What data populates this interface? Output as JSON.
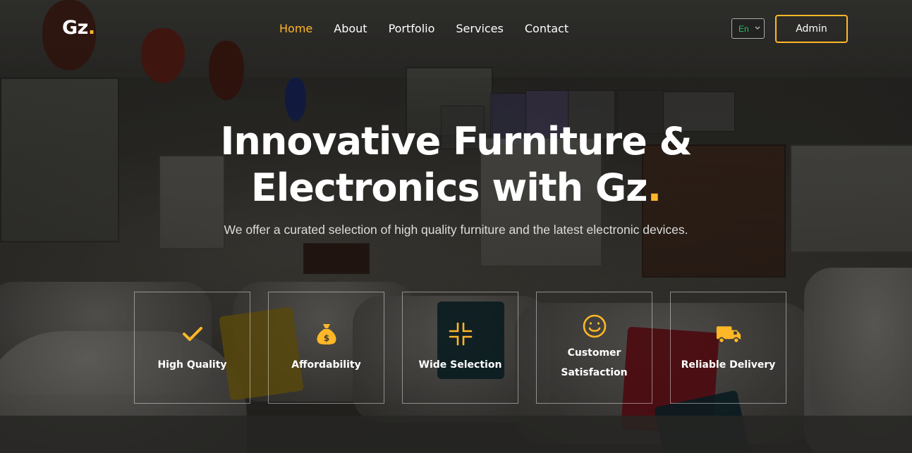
{
  "brand": {
    "name": "Gz",
    "dot": ".",
    "accent": "#ffb727"
  },
  "nav": {
    "items": [
      {
        "label": "Home",
        "active": true
      },
      {
        "label": "About",
        "active": false
      },
      {
        "label": "Portfolio",
        "active": false
      },
      {
        "label": "Services",
        "active": false
      },
      {
        "label": "Contact",
        "active": false
      }
    ]
  },
  "language": {
    "selected": "En"
  },
  "admin_button": {
    "label": "Admin"
  },
  "hero": {
    "title_line1": "Innovative Furniture &",
    "title_line2": "Electronics with Gz",
    "title_dot": ".",
    "subtitle": "We offer a curated selection of high quality furniture and the latest electronic devices."
  },
  "features": [
    {
      "label": "High Quality",
      "icon": "check-icon"
    },
    {
      "label": "Affordability",
      "icon": "money-bag-icon"
    },
    {
      "label": "Wide Selection",
      "icon": "collapse-arrows-icon"
    },
    {
      "label": "Customer Satisfaction",
      "icon": "smiley-icon"
    },
    {
      "label": "Reliable Delivery",
      "icon": "truck-icon"
    }
  ],
  "colors": {
    "accent": "#ffb727",
    "lang_text": "#22c55e"
  }
}
